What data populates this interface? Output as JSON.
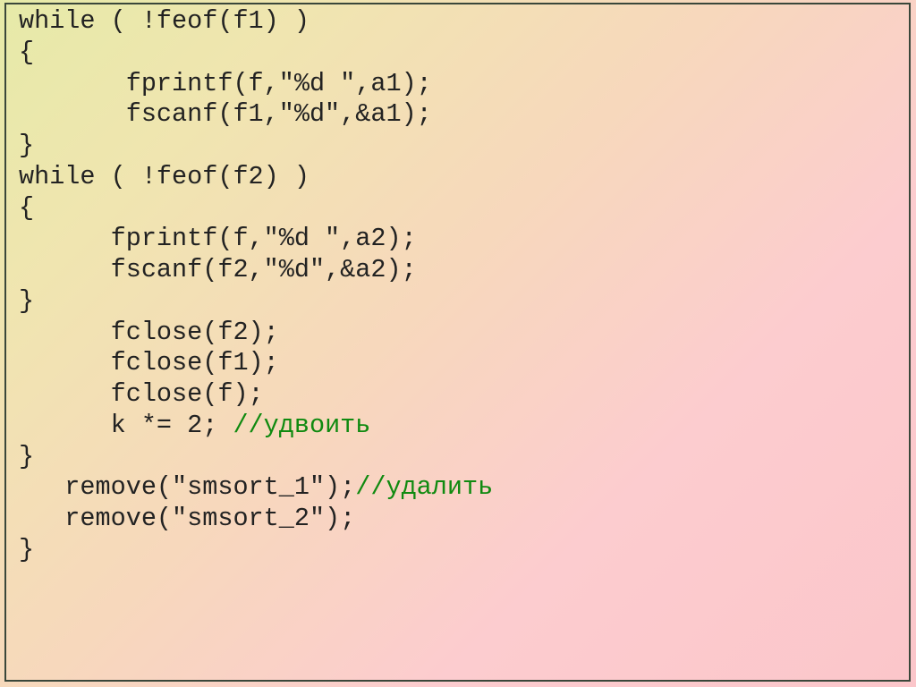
{
  "code": {
    "l01": "while ( !feof(f1) )",
    "l02": "{",
    "l03": "       fprintf(f,\"%d \",a1);",
    "l04": "       fscanf(f1,\"%d\",&a1);",
    "l05": "}",
    "l06": "while ( !feof(f2) )",
    "l07": "{",
    "l08": "      fprintf(f,\"%d \",a2);",
    "l09": "      fscanf(f2,\"%d\",&a2);",
    "l10": "}",
    "l11": "      fclose(f2);",
    "l12": "      fclose(f1);",
    "l13": "      fclose(f);",
    "l14a": "      k *= 2; ",
    "l14b": "//удвоить",
    "l15": "}",
    "l16a": "   remove(\"smsort_1\");",
    "l16b": "//удалить",
    "l17": "   remove(\"smsort_2\");",
    "l18": "}"
  }
}
